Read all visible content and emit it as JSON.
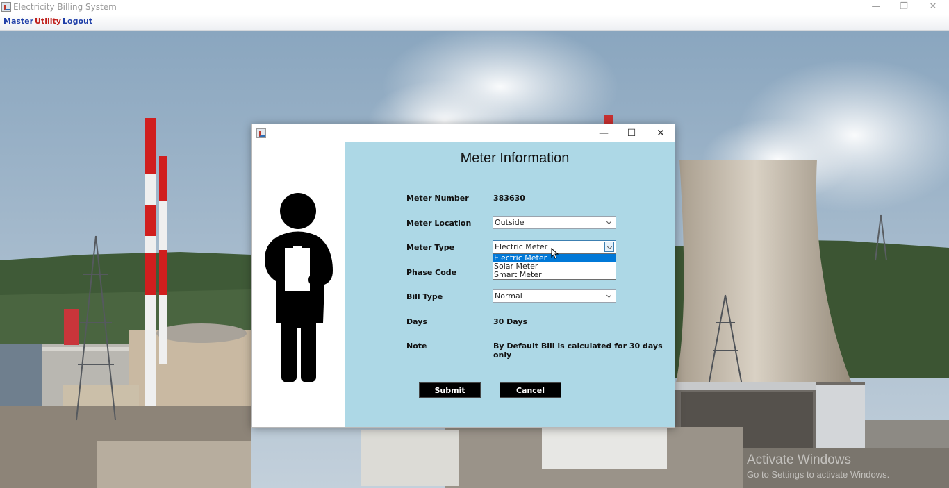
{
  "window": {
    "title": "Electricity Billing System",
    "controls": {
      "minimize": "—",
      "restore": "❐",
      "close": "✕"
    }
  },
  "menu": [
    {
      "label": "Master",
      "color": "#1f3fa8"
    },
    {
      "label": "Utility",
      "color": "#c0201c"
    },
    {
      "label": "Logout",
      "color": "#1f3fa8"
    }
  ],
  "dialog": {
    "controls": {
      "minimize": "—",
      "maximize": "☐",
      "close": "✕"
    },
    "illustration": "person-with-clipboard-icon",
    "title": "Meter Information",
    "fields": {
      "meter_number": {
        "label": "Meter Number",
        "value": "383630"
      },
      "meter_location": {
        "label": "Meter Location",
        "value": "Outside"
      },
      "meter_type": {
        "label": "Meter Type",
        "value": "Electric Meter",
        "options": [
          "Electric Meter",
          "Solar Meter",
          "Smart Meter"
        ],
        "selected_option": "Electric Meter"
      },
      "phase_code": {
        "label": "Phase Code"
      },
      "bill_type": {
        "label": "Bill Type",
        "value": "Normal"
      },
      "days": {
        "label": "Days",
        "value": "30 Days"
      },
      "note": {
        "label": "Note",
        "value": "By Default Bill is calculated for 30 days only"
      }
    },
    "buttons": {
      "submit": "Submit",
      "cancel": "Cancel"
    }
  },
  "watermark": {
    "line1": "Activate Windows",
    "line2": "Go to Settings to activate Windows."
  },
  "colors": {
    "form_background": "#add8e6",
    "menu_blue": "#1f3fa8",
    "menu_red": "#c0201c",
    "dropdown_selected": "#0078d7",
    "button": "#000000"
  }
}
